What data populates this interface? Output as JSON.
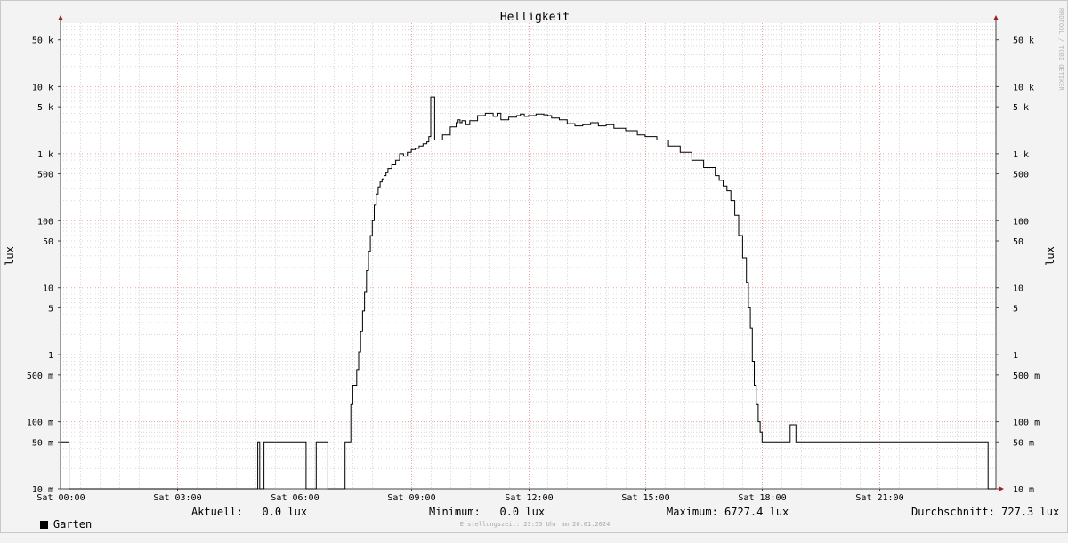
{
  "chart_data": {
    "type": "line",
    "title": "Helligkeit",
    "ylabel": "lux",
    "yscale": "log",
    "ylim": [
      0.01,
      100000
    ],
    "xlim": [
      0,
      24
    ],
    "grid": true,
    "x_ticks": [
      {
        "x": 0,
        "label": "Sat 00:00"
      },
      {
        "x": 3,
        "label": "Sat 03:00"
      },
      {
        "x": 6,
        "label": "Sat 06:00"
      },
      {
        "x": 9,
        "label": "Sat 09:00"
      },
      {
        "x": 12,
        "label": "Sat 12:00"
      },
      {
        "x": 15,
        "label": "Sat 15:00"
      },
      {
        "x": 18,
        "label": "Sat 18:00"
      },
      {
        "x": 21,
        "label": "Sat 21:00"
      }
    ],
    "y_ticks": [
      {
        "v": 0.01,
        "label": "10 m"
      },
      {
        "v": 0.05,
        "label": "50 m"
      },
      {
        "v": 0.1,
        "label": "100 m"
      },
      {
        "v": 0.5,
        "label": "500 m"
      },
      {
        "v": 1,
        "label": "1"
      },
      {
        "v": 5,
        "label": "5"
      },
      {
        "v": 10,
        "label": "10"
      },
      {
        "v": 50,
        "label": "50"
      },
      {
        "v": 100,
        "label": "100"
      },
      {
        "v": 500,
        "label": "500"
      },
      {
        "v": 1000,
        "label": "1 k"
      },
      {
        "v": 5000,
        "label": "5 k"
      },
      {
        "v": 10000,
        "label": "10 k"
      },
      {
        "v": 50000,
        "label": "50 k"
      }
    ],
    "series": [
      {
        "name": "Garten",
        "color": "#000000",
        "x": [
          -0.05,
          0.2,
          0.22,
          5.05,
          5.06,
          5.1,
          5.11,
          5.21,
          5.22,
          6.29,
          6.3,
          6.55,
          6.56,
          6.85,
          6.86,
          7.29,
          7.3,
          7.45,
          7.5,
          7.6,
          7.65,
          7.7,
          7.75,
          7.8,
          7.85,
          7.9,
          7.95,
          8.0,
          8.05,
          8.1,
          8.15,
          8.2,
          8.25,
          8.3,
          8.35,
          8.4,
          8.5,
          8.6,
          8.7,
          8.8,
          8.9,
          9.0,
          9.1,
          9.2,
          9.3,
          9.4,
          9.45,
          9.5,
          9.6,
          9.8,
          10.0,
          10.15,
          10.2,
          10.25,
          10.3,
          10.4,
          10.5,
          10.7,
          10.9,
          11.1,
          11.2,
          11.3,
          11.5,
          11.7,
          11.8,
          11.9,
          12.0,
          12.2,
          12.4,
          12.5,
          12.6,
          12.8,
          13.0,
          13.2,
          13.4,
          13.6,
          13.8,
          14.0,
          14.2,
          14.5,
          14.8,
          15.0,
          15.3,
          15.6,
          15.9,
          16.2,
          16.5,
          16.8,
          16.9,
          17.0,
          17.1,
          17.2,
          17.3,
          17.4,
          17.5,
          17.6,
          17.65,
          17.7,
          17.75,
          17.8,
          17.85,
          17.9,
          17.95,
          18.0,
          18.05,
          18.1,
          18.15,
          18.7,
          18.72,
          18.85,
          18.87,
          23.78,
          23.8,
          24.05
        ],
        "y": [
          0.05,
          0.05,
          0.01,
          0.01,
          0.05,
          0.05,
          0.01,
          0.01,
          0.05,
          0.05,
          0.01,
          0.01,
          0.05,
          0.05,
          0.01,
          0.01,
          0.05,
          0.18,
          0.35,
          0.6,
          1.1,
          2.2,
          4.5,
          8.5,
          18,
          35,
          60,
          100,
          170,
          250,
          320,
          380,
          420,
          470,
          520,
          600,
          680,
          800,
          1000,
          920,
          1050,
          1150,
          1200,
          1300,
          1400,
          1500,
          1800,
          7000,
          1600,
          1900,
          2500,
          2900,
          3200,
          2900,
          3100,
          2700,
          3100,
          3700,
          4000,
          3600,
          4000,
          3200,
          3500,
          3700,
          3900,
          3600,
          3700,
          3900,
          3800,
          3700,
          3400,
          3200,
          2800,
          2600,
          2700,
          2900,
          2600,
          2700,
          2400,
          2200,
          1900,
          1800,
          1600,
          1300,
          1050,
          800,
          620,
          470,
          400,
          330,
          280,
          200,
          120,
          60,
          28,
          12,
          5,
          2.5,
          0.8,
          0.35,
          0.18,
          0.1,
          0.07,
          0.05,
          0.05,
          0.05,
          0.05,
          0.05,
          0.09,
          0.09,
          0.05,
          0.05,
          0.01,
          0.01
        ]
      }
    ]
  },
  "legend": {
    "swatch_color": "#000000",
    "series_name": "Garten",
    "aktuell": "Aktuell:   0.0 lux",
    "minimum": "Minimum:   0.0 lux",
    "maximum": "Maximum: 6727.4 lux",
    "durchschnitt": "Durchschnitt: 727.3 lux"
  },
  "footer": "Erstellungszeit: 23:55 Uhr am 20.01.2024",
  "watermark": "RRDTOOL / TOBI OETIKER",
  "colors": {
    "background": "#f3f3f3",
    "plot_background": "#ffffff",
    "major_grid": "#e9a2a2",
    "minor_grid": "#d8d8d8",
    "axis": "#444444",
    "arrow": "#a02020",
    "series": "#000000"
  }
}
